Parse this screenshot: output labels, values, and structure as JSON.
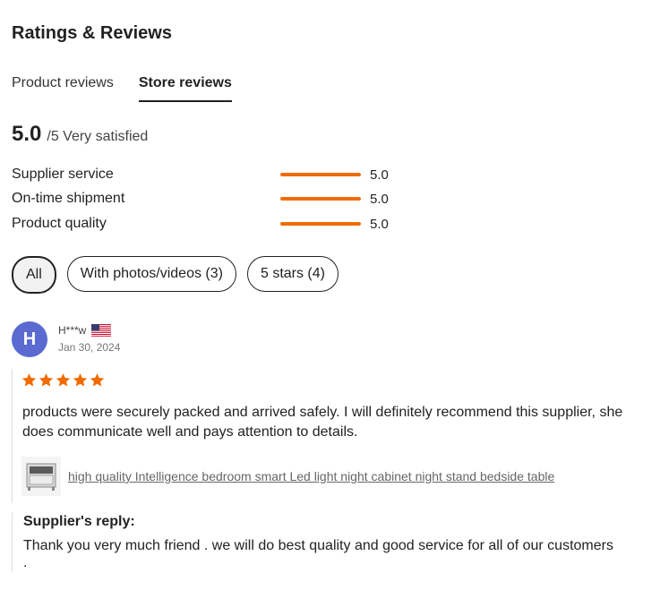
{
  "header": {
    "title": "Ratings & Reviews"
  },
  "tabs": [
    {
      "label": "Product reviews",
      "active": false
    },
    {
      "label": "Store reviews",
      "active": true
    }
  ],
  "score": {
    "value": "5.0",
    "suffix": "/5 Very satisfied"
  },
  "metrics": [
    {
      "label": "Supplier service",
      "value": "5.0",
      "fraction": 1.0
    },
    {
      "label": "On-time shipment",
      "value": "5.0",
      "fraction": 1.0
    },
    {
      "label": "Product quality",
      "value": "5.0",
      "fraction": 1.0
    }
  ],
  "filters": [
    {
      "label": "All",
      "active": true
    },
    {
      "label": "With photos/videos (3)",
      "active": false
    },
    {
      "label": "5 stars (4)",
      "active": false
    }
  ],
  "review": {
    "avatar_letter": "H",
    "reviewer": "H***w",
    "country_flag": "us-flag-icon",
    "date": "Jan 30, 2024",
    "rating": 5,
    "text": "products were securely packed and arrived safely. I will definitely recommend this supplier, she does communicate well and pays attention to details.",
    "product_link": "high quality Intelligence bedroom smart Led light night cabinet night stand bedside table",
    "reply_title": "Supplier's reply:",
    "reply_text": "Thank you very much friend . we will do best quality and good service for all of our customers ."
  },
  "colors": {
    "accent": "#f06b00",
    "avatar": "#5b6ad0",
    "star": "#f06b00"
  }
}
